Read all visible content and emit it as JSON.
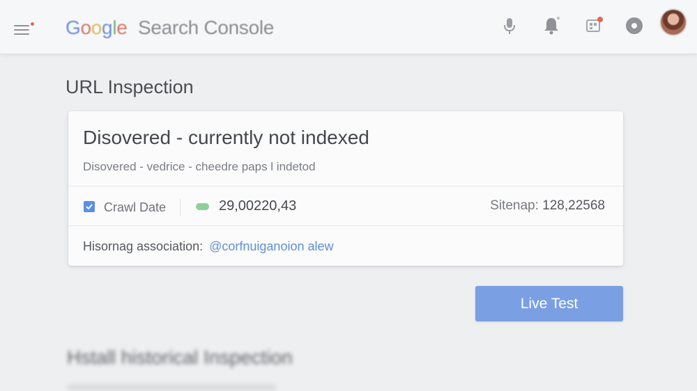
{
  "header": {
    "brand_letters": [
      "G",
      "o",
      "o",
      "g",
      "l",
      "e"
    ],
    "product": "Search Console",
    "icons": [
      "menu-icon",
      "mic-icon",
      "bell-icon",
      "apps-icon",
      "help-icon",
      "avatar"
    ]
  },
  "page": {
    "title": "URL Inspection"
  },
  "card": {
    "title": "Disovered - currently not indexed",
    "subtitle": "Disovered - vedrice - cheedre paps l indetod",
    "crawl_label": "Crawl Date",
    "crawl_checked": true,
    "crawl_value": "29,00220,43",
    "sitemap_label": "Sitenap:",
    "sitemap_value": "128,22568",
    "association_label": "Hisornag association:",
    "association_link": "@corfnuiganoion alew"
  },
  "actions": {
    "live_test": "Live Test"
  },
  "history": {
    "title": "Hstall historical Inspection"
  },
  "colors": {
    "accent": "#7a9fe3",
    "link": "#5f8fd6",
    "status_ok": "#8fcf9b",
    "background": "#eeeff1"
  }
}
